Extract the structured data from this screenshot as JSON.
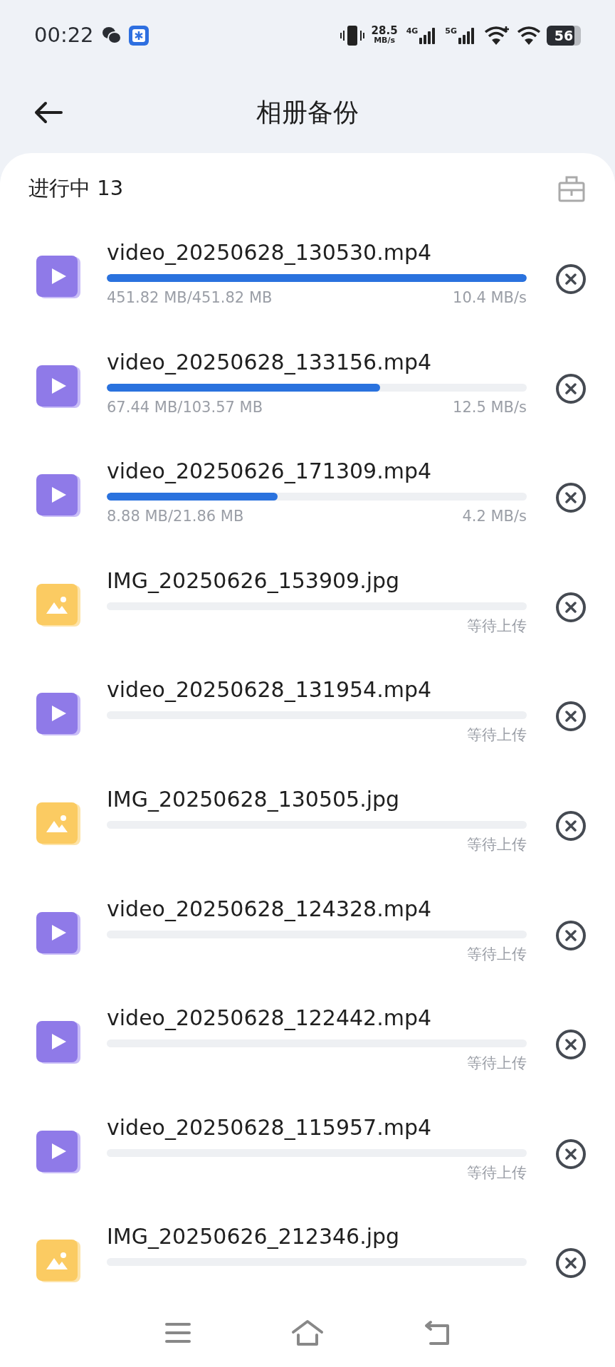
{
  "status_bar": {
    "time": "00:22",
    "net_speed": "28.5",
    "net_speed_unit": "MB/s",
    "signal_1_label": "4G",
    "signal_2_label": "5G",
    "battery": "56"
  },
  "header": {
    "title": "相册备份"
  },
  "section": {
    "label": "进行中 13"
  },
  "uploads": [
    {
      "kind": "video",
      "name": "video_20250628_130530.mp4",
      "level": 1,
      "progress": "451.82 MB/451.82 MB",
      "speed": "10.4 MB/s"
    },
    {
      "kind": "video",
      "name": "video_20250628_133156.mp4",
      "level": 0.65,
      "progress": "67.44 MB/103.57 MB",
      "speed": "12.5 MB/s"
    },
    {
      "kind": "video",
      "name": "video_20250626_171309.mp4",
      "level": 0.406,
      "progress": "8.88 MB/21.86 MB",
      "speed": "4.2 MB/s"
    },
    {
      "kind": "image",
      "name": "IMG_20250626_153909.jpg",
      "level": 0,
      "status": "等待上传"
    },
    {
      "kind": "video",
      "name": "video_20250628_131954.mp4",
      "level": 0,
      "status": "等待上传"
    },
    {
      "kind": "image",
      "name": "IMG_20250628_130505.jpg",
      "level": 0,
      "status": "等待上传"
    },
    {
      "kind": "video",
      "name": "video_20250628_124328.mp4",
      "level": 0,
      "status": "等待上传"
    },
    {
      "kind": "video",
      "name": "video_20250628_122442.mp4",
      "level": 0,
      "status": "等待上传"
    },
    {
      "kind": "video",
      "name": "video_20250628_115957.mp4",
      "level": 0,
      "status": "等待上传"
    },
    {
      "kind": "image",
      "name": "IMG_20250626_212346.jpg",
      "level": 0
    }
  ]
}
